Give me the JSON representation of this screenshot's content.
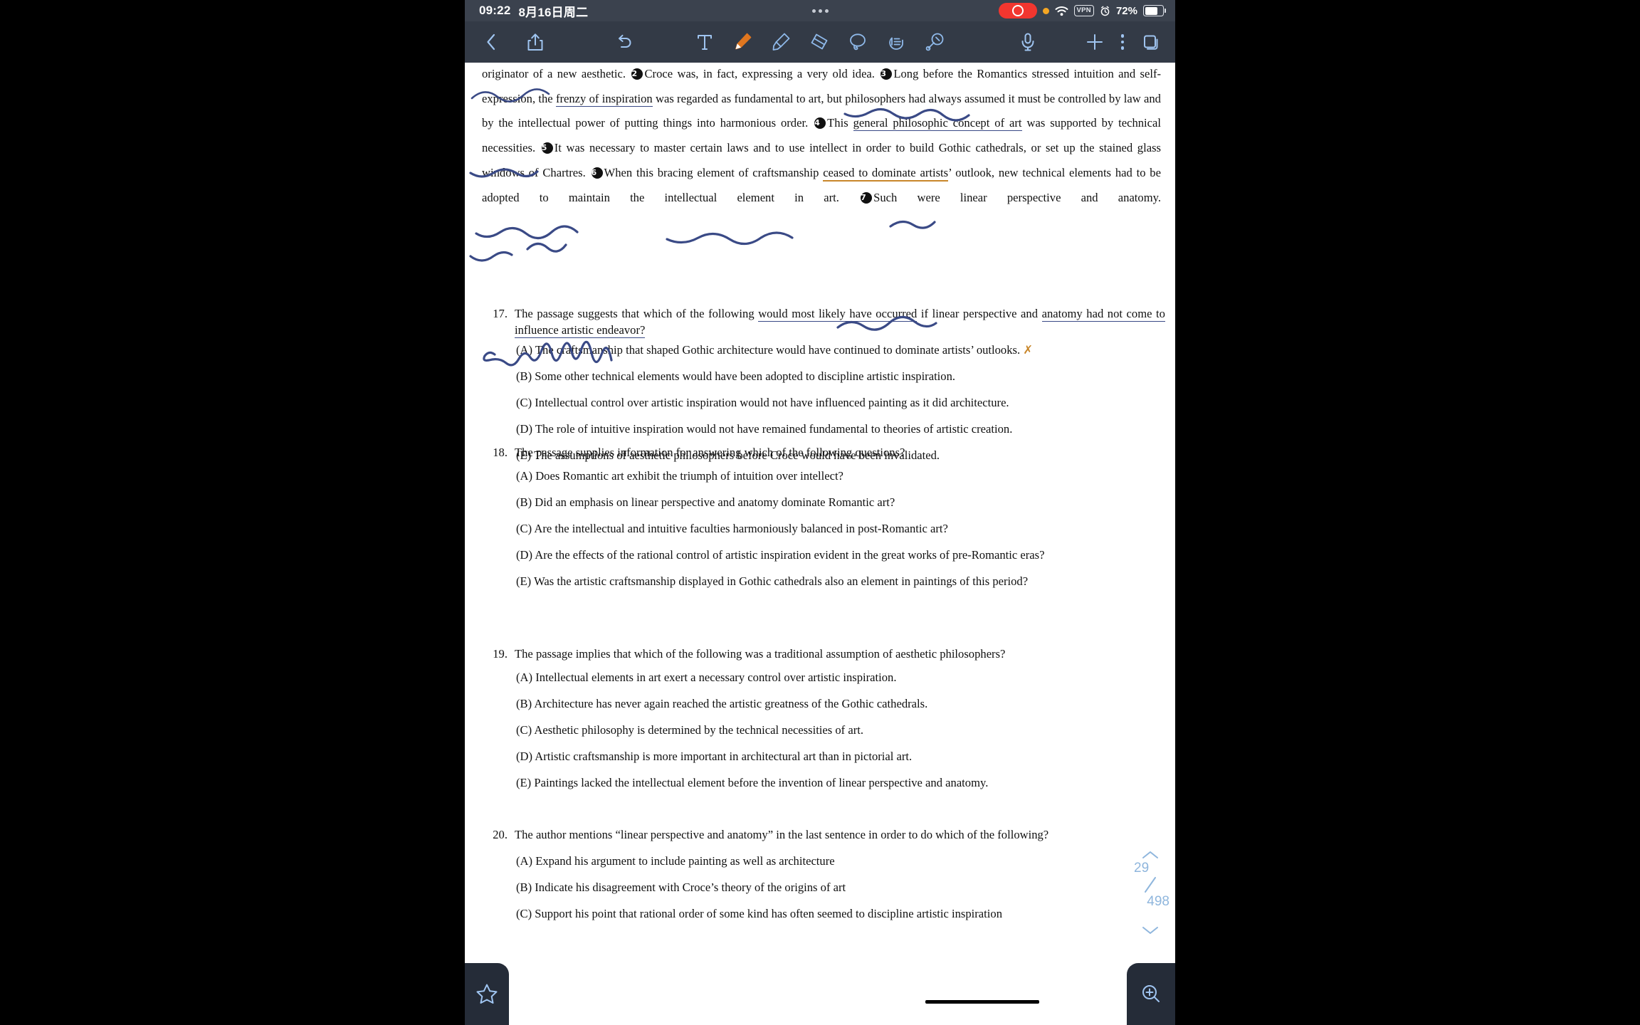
{
  "statusbar": {
    "time": "09:22",
    "date": "8月16日周二",
    "battery_percent": "72%",
    "vpn_label": "VPN",
    "icons": [
      "recording-pill",
      "orange-dot",
      "wifi-icon",
      "vpn-badge",
      "alarm-icon",
      "battery-icon"
    ]
  },
  "toolbar": {
    "back": "back-chevron-icon",
    "share": "share-icon",
    "undo": "undo-icon",
    "tools": [
      {
        "name": "text-tool",
        "label": "T",
        "selected": false
      },
      {
        "name": "pencil-tool",
        "label": "Pencil",
        "selected": true
      },
      {
        "name": "highlighter-tool",
        "label": "Highlighter",
        "selected": false
      },
      {
        "name": "eraser-tool",
        "label": "Eraser",
        "selected": false
      },
      {
        "name": "lasso-tool",
        "label": "Lasso",
        "selected": false
      },
      {
        "name": "hand-tool",
        "label": "Hand",
        "selected": false
      },
      {
        "name": "shape-tool",
        "label": "Shape",
        "selected": false
      }
    ],
    "mic": "microphone-icon",
    "add": "plus-icon",
    "more": "more-menu-icon",
    "pages": "pages-icon"
  },
  "document": {
    "passage": {
      "line_start": "originator of a new aesthetic.",
      "seg2_marker": "2",
      "seg2": "Croce was, in fact, expressing a very old idea.",
      "seg3_marker": "3",
      "seg3_a": "Long before the Romantics stressed intuition and self-expression, the",
      "seg3_hl": "frenzy of inspiration",
      "seg3_b": "was regarded as fundamental to art, but philosophers had always assumed it must be controlled by law and by the intellectual power of putting things into harmonious order.",
      "seg4_marker": "4",
      "seg4_a": "This",
      "seg4_hl": "general philosophic concept of art",
      "seg4_b": "was supported by technical necessities.",
      "seg5_marker": "5",
      "seg5": "It was necessary to master certain laws and to use intellect in order to build Gothic cathedrals, or set up the stained glass windows of Chartres.",
      "seg6_marker": "6",
      "seg6_a": "When this bracing element of craftsmanship",
      "seg6_hl": "ceased to dominate artists",
      "seg6_b": "’ outlook, new technical elements had to be adopted to maintain the intellectual element in art.",
      "seg7_marker": "7",
      "seg7": "Such were linear perspective and anatomy."
    },
    "questions": [
      {
        "number": "17.",
        "stem_a": "The passage suggests that which of the following",
        "stem_hl": "would most likely have occurred",
        "stem_b": "if linear perspective and",
        "stem_line2_hl": "anatomy had not come to influence artistic endeavor?",
        "options": [
          {
            "label": "(A)",
            "text": "The craftsmanship that shaped Gothic architecture would have continued to dominate artists’ outlooks.",
            "mark": "x-mark"
          },
          {
            "label": "(B)",
            "text": "Some other technical elements would have been adopted to discipline artistic inspiration."
          },
          {
            "label": "(C)",
            "text": "Intellectual control over artistic inspiration would not have influenced painting as it did architecture."
          },
          {
            "label": "(D)",
            "text": "The role of intuitive inspiration would not have remained fundamental to theories of artistic creation."
          },
          {
            "label": "(E)",
            "text": "The assumptions of aesthetic philosophers before Croce would have been invalidated."
          }
        ]
      },
      {
        "number": "18.",
        "stem": "The passage supplies information for answering which of the following questions?",
        "options": [
          {
            "label": "(A)",
            "text": "Does Romantic art exhibit the triumph of intuition over intellect?"
          },
          {
            "label": "(B)",
            "text": "Did an emphasis on linear perspective and anatomy dominate Romantic art?"
          },
          {
            "label": "(C)",
            "text": "Are the intellectual and intuitive faculties harmoniously balanced in post-Romantic art?"
          },
          {
            "label": "(D)",
            "text": "Are the effects of the rational control of artistic inspiration evident in the great works of pre-Romantic eras?"
          },
          {
            "label": "(E)",
            "text": "Was the artistic craftsmanship displayed in Gothic cathedrals also an element in paintings of this period?"
          }
        ]
      },
      {
        "number": "19.",
        "stem": "The passage implies that which of the following was a traditional assumption of aesthetic philosophers?",
        "options": [
          {
            "label": "(A)",
            "text": "Intellectual elements in art exert a necessary control over artistic inspiration."
          },
          {
            "label": "(B)",
            "text": "Architecture has never again reached the artistic greatness of the Gothic cathedrals."
          },
          {
            "label": "(C)",
            "text": "Aesthetic philosophy is determined by the technical necessities of art."
          },
          {
            "label": "(D)",
            "text": "Artistic craftsmanship is more important in architectural art than in pictorial art."
          },
          {
            "label": "(E)",
            "text": "Paintings lacked the intellectual element before the invention of linear perspective and anatomy."
          }
        ]
      },
      {
        "number": "20.",
        "stem": "The author mentions “linear perspective and anatomy” in the last sentence in order to do which of the following?",
        "options": [
          {
            "label": "(A)",
            "text": "Expand his argument to include painting as well as architecture"
          },
          {
            "label": "(B)",
            "text": "Indicate his disagreement with Croce’s theory of the origins of art"
          },
          {
            "label": "(C)",
            "text": "Support his point that rational order of some kind has often seemed to discipline artistic inspiration"
          }
        ]
      }
    ]
  },
  "page_indicator": {
    "current": "29",
    "total": "498",
    "up_icon": "chevron-up-icon",
    "down_icon": "chevron-down-icon"
  },
  "floating": {
    "star": "star-icon",
    "zoom_in": "zoom-in-icon"
  },
  "colors": {
    "toolbar_bg": "#333a46",
    "statusbar_bg": "#3b424e",
    "accent_blue": "#9fc4f0",
    "ink_blue": "#3a4a86",
    "ink_orange": "#c8862a",
    "recording_red": "#f2362f"
  }
}
